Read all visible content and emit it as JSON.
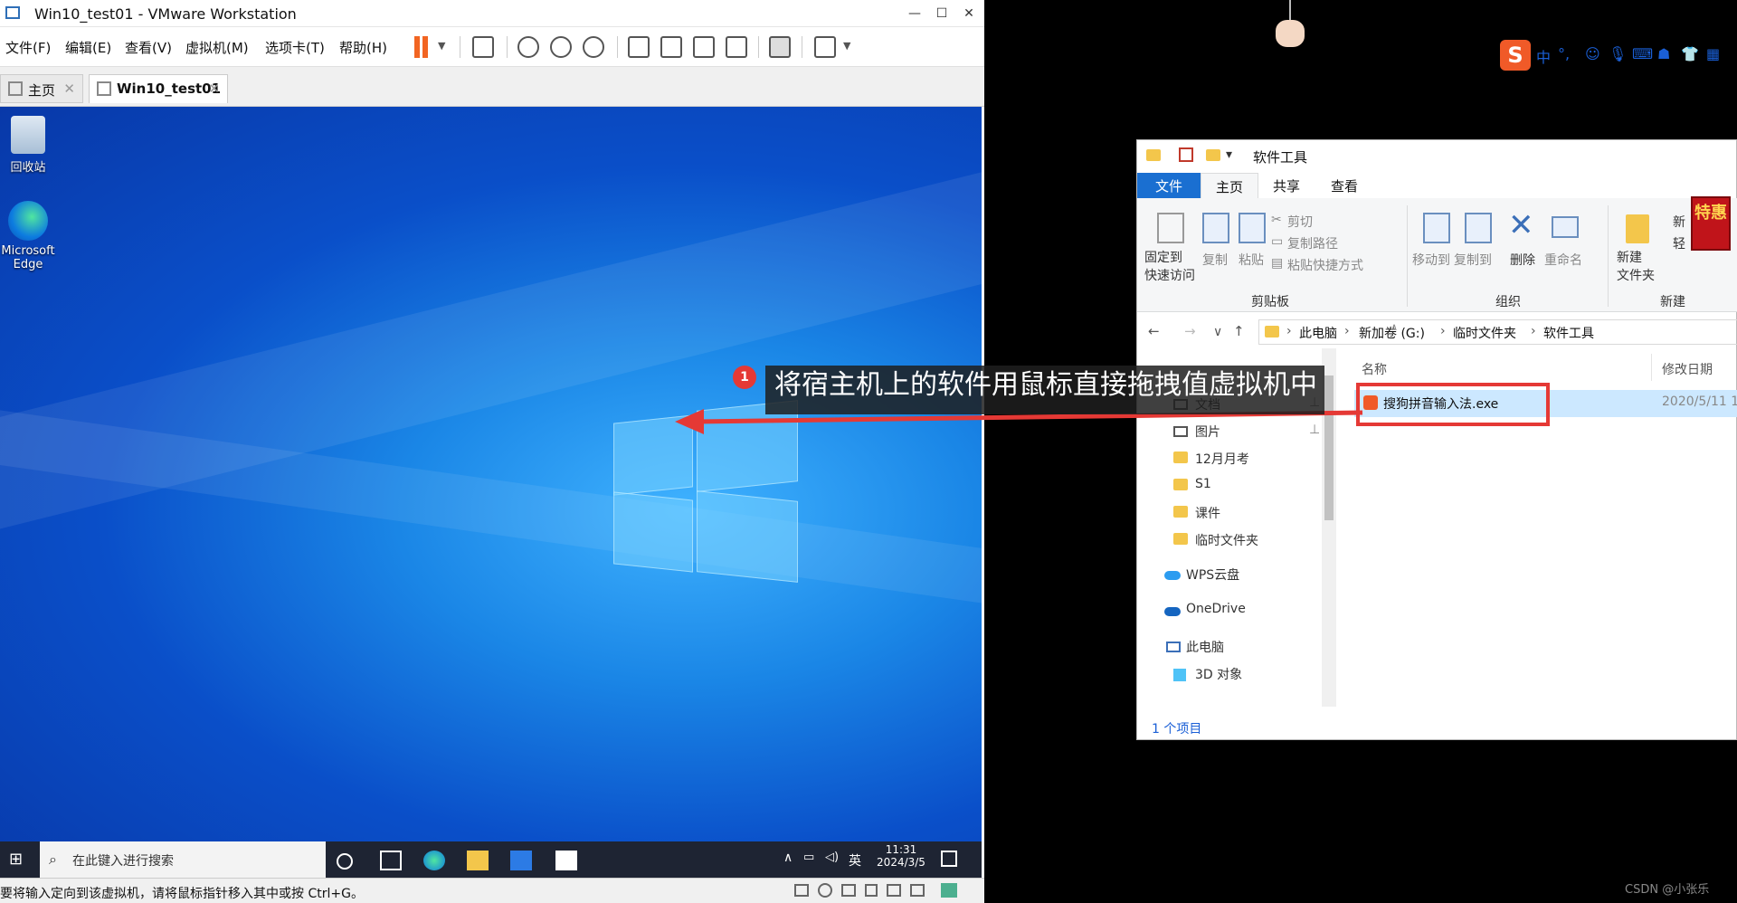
{
  "vmware": {
    "title": "Win10_test01 - VMware Workstation",
    "menu": [
      "文件(F)",
      "编辑(E)",
      "查看(V)",
      "虚拟机(M)",
      "选项卡(T)",
      "帮助(H)"
    ],
    "tabs": [
      {
        "label": "主页",
        "active": false
      },
      {
        "label": "Win10_test01",
        "active": true
      }
    ],
    "status_text": "要将输入定向到该虚拟机，请将鼠标指针移入其中或按 Ctrl+G。"
  },
  "guest": {
    "desktop_icons": [
      {
        "label": "回收站",
        "icon": "recycle-bin-icon"
      },
      {
        "label": "Microsoft Edge",
        "icon": "edge-icon"
      }
    ],
    "taskbar": {
      "search_placeholder": "在此键入进行搜索",
      "ime": "英",
      "time": "11:31",
      "date": "2024/3/5"
    }
  },
  "annotation": {
    "badge": "1",
    "text": "将宿主机上的软件用鼠标直接拖拽值虚拟机中",
    "color": "#e53935"
  },
  "explorer": {
    "title": "软件工具",
    "ribbon_tabs": [
      "文件",
      "主页",
      "共享",
      "查看"
    ],
    "ribbon": {
      "clipboard": {
        "pin": "固定到\n快速访问",
        "copy": "复制",
        "paste": "粘贴",
        "cut": "剪切",
        "copy_path": "复制路径",
        "paste_shortcut": "粘贴快捷方式",
        "group": "剪贴板"
      },
      "organize": {
        "move_to": "移动到",
        "copy_to": "复制到",
        "delete": "删除",
        "rename": "重命名",
        "group": "组织"
      },
      "new": {
        "new_folder": "新建\n文件夹",
        "new_item": "新",
        "easy_access": "轻",
        "group": "新建"
      }
    },
    "breadcrumb": [
      "此电脑",
      "新加卷 (G:)",
      "临时文件夹",
      "软件工具"
    ],
    "nav": [
      {
        "label": "文档",
        "pinned": true
      },
      {
        "label": "图片",
        "pinned": true
      },
      {
        "label": "12月月考",
        "pinned": false
      },
      {
        "label": "S1",
        "pinned": false
      },
      {
        "label": "课件",
        "pinned": false
      },
      {
        "label": "临时文件夹",
        "pinned": false
      },
      {
        "label": "WPS云盘",
        "pinned": false
      },
      {
        "label": "OneDrive",
        "pinned": false
      },
      {
        "label": "此电脑",
        "pinned": false
      },
      {
        "label": "3D 对象",
        "pinned": false
      }
    ],
    "columns": {
      "name": "名称",
      "modified": "修改日期"
    },
    "files": [
      {
        "name": "搜狗拼音输入法.exe",
        "modified": "2020/5/11 1"
      }
    ],
    "status": "1 个项目",
    "promo_badge": "特惠"
  },
  "ime_toolbar": {
    "logo": "S",
    "mode": "中",
    "punct": "°,"
  },
  "watermark": "CSDN @小张乐"
}
